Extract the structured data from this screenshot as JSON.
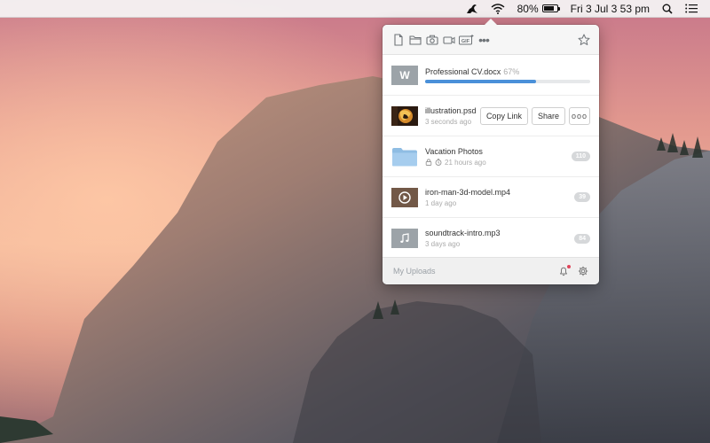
{
  "menubar": {
    "battery_percent": "80%",
    "battery_level": 0.8,
    "datetime": "Fri 3 Jul  3 53 pm",
    "icons": [
      "kangaroo-app-icon",
      "wifi-icon",
      "battery-icon",
      "spotlight-search-icon",
      "notification-center-icon"
    ]
  },
  "toolbar": {
    "icons": [
      "new-file-icon",
      "folder-icon",
      "camera-icon",
      "video-icon",
      "gif-icon",
      "more-icon",
      "star-icon"
    ],
    "gif_label": "GIF",
    "more_label": "•••"
  },
  "files": [
    {
      "name": "Professional CV.docx",
      "percent": "67%",
      "progress": 0.67,
      "thumb_letter": "W",
      "thumb_type": "word-document"
    },
    {
      "name": "illustration.psd",
      "time": "3 seconds ago",
      "thumb_type": "image",
      "actions": {
        "copy_link": "Copy Link",
        "share": "Share",
        "more": "ooo"
      }
    },
    {
      "name": "Vacation Photos",
      "time": "21 hours ago",
      "count": "110",
      "thumb_type": "folder"
    },
    {
      "name": "iron-man-3d-model.mp4",
      "time": "1 day ago",
      "count": "39",
      "thumb_type": "video"
    },
    {
      "name": "soundtrack-intro.mp3",
      "time": "3 days ago",
      "count": "84",
      "thumb_type": "audio"
    }
  ],
  "footer": {
    "label": "My Uploads",
    "has_notification": true
  },
  "colors": {
    "accent": "#4a90d9",
    "notification": "#e0455a"
  }
}
